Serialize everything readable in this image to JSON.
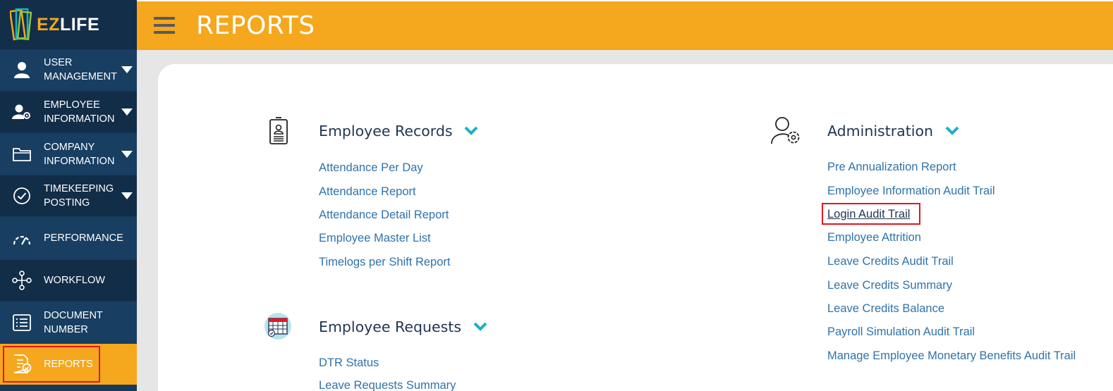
{
  "app": {
    "logo_ez": "EZ",
    "logo_life": "LIFE"
  },
  "header": {
    "title": "REPORTS"
  },
  "sidebar": {
    "items": [
      {
        "label_line1": "USER",
        "label_line2": "MANAGEMENT",
        "icon": "user-icon"
      },
      {
        "label_line1": "EMPLOYEE",
        "label_line2": "INFORMATION",
        "icon": "user-gear-icon"
      },
      {
        "label_line1": "COMPANY",
        "label_line2": "INFORMATION",
        "icon": "folder-icon"
      },
      {
        "label_line1": "TIMEKEEPING",
        "label_line2": "POSTING",
        "icon": "check-circle-icon"
      },
      {
        "label_line1": "PERFORMANCE",
        "label_line2": "",
        "icon": "gauge-icon"
      },
      {
        "label_line1": "WORKFLOW",
        "label_line2": "",
        "icon": "workflow-icon"
      },
      {
        "label_line1": "DOCUMENT",
        "label_line2": "NUMBER",
        "icon": "document-list-icon"
      },
      {
        "label_line1": "REPORTS",
        "label_line2": "",
        "icon": "report-check-icon"
      }
    ]
  },
  "sections": {
    "employee_records": {
      "title": "Employee Records",
      "links": [
        "Attendance Per Day",
        "Attendance Report",
        "Attendance Detail Report",
        "Employee Master List",
        "Timelogs per Shift Report"
      ]
    },
    "employee_requests": {
      "title": "Employee Requests",
      "links": [
        "DTR Status",
        "Leave Requests Summary"
      ]
    },
    "administration": {
      "title": "Administration",
      "links": [
        "Pre Annualization Report",
        "Employee Information Audit Trail",
        "Login Audit Trail",
        "Employee Attrition",
        "Leave Credits Audit Trail",
        "Leave Credits Summary",
        "Leave Credits Balance",
        "Payroll Simulation Audit Trail",
        "Manage Employee Monetary Benefits Audit Trail"
      ]
    }
  },
  "colors": {
    "accent": "#f5a71d",
    "sidebar": "#173a5c",
    "link": "#2f73ab",
    "highlight": "#e3161f",
    "chevron": "#1ab0c4"
  }
}
